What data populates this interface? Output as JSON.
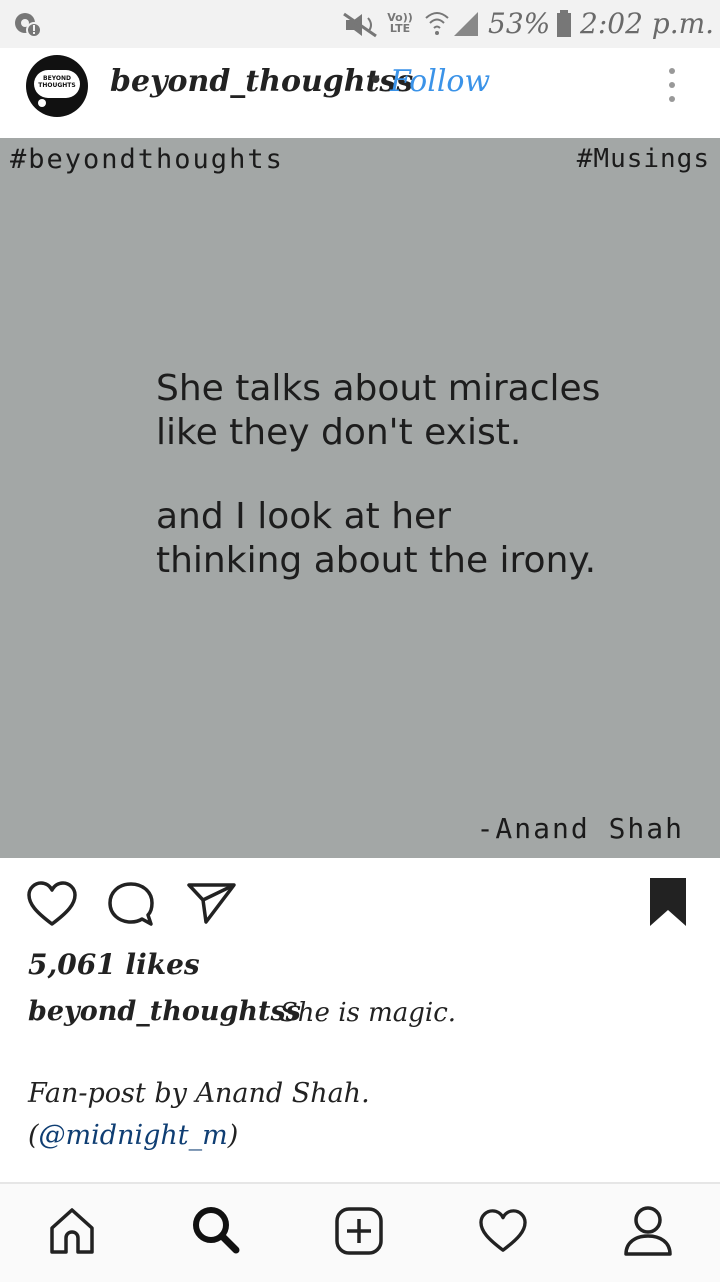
{
  "status_bar": {
    "signal_label": "Vo)) LTE",
    "battery": "53%",
    "time": "2:02 p.m."
  },
  "header": {
    "avatar_text": "BEYOND THOUGHTS",
    "username": "beyond_thoughtss",
    "separator": "•",
    "follow_label": "Follow"
  },
  "post": {
    "tag_left": "#beyondthoughts",
    "tag_right": "#Musings",
    "quote_lines": [
      "She talks about miracles",
      "like they don't exist.",
      "and I look at her",
      "thinking about the irony."
    ],
    "author": "-Anand  Shah"
  },
  "actions": {
    "likes": "5,061 likes"
  },
  "caption": {
    "username": "beyond_thoughtss",
    "text": "She is magic.",
    "line2": "Fan-post by Anand Shah.",
    "line3_open": "(",
    "mention": "@midnight_m",
    "line3_close": ")"
  },
  "icons": {
    "status": [
      "notification-icon",
      "mute-icon",
      "wifi-icon",
      "signal-icon",
      "battery-icon"
    ],
    "actions": [
      "heart-icon",
      "comment-icon",
      "share-icon",
      "bookmark-icon"
    ],
    "nav": [
      "home-icon",
      "search-icon",
      "add-post-icon",
      "activity-heart-icon",
      "profile-icon"
    ]
  },
  "colors": {
    "follow": "#3b93e8",
    "post_background": "#a3a7a6",
    "mention": "#0f3e73"
  }
}
